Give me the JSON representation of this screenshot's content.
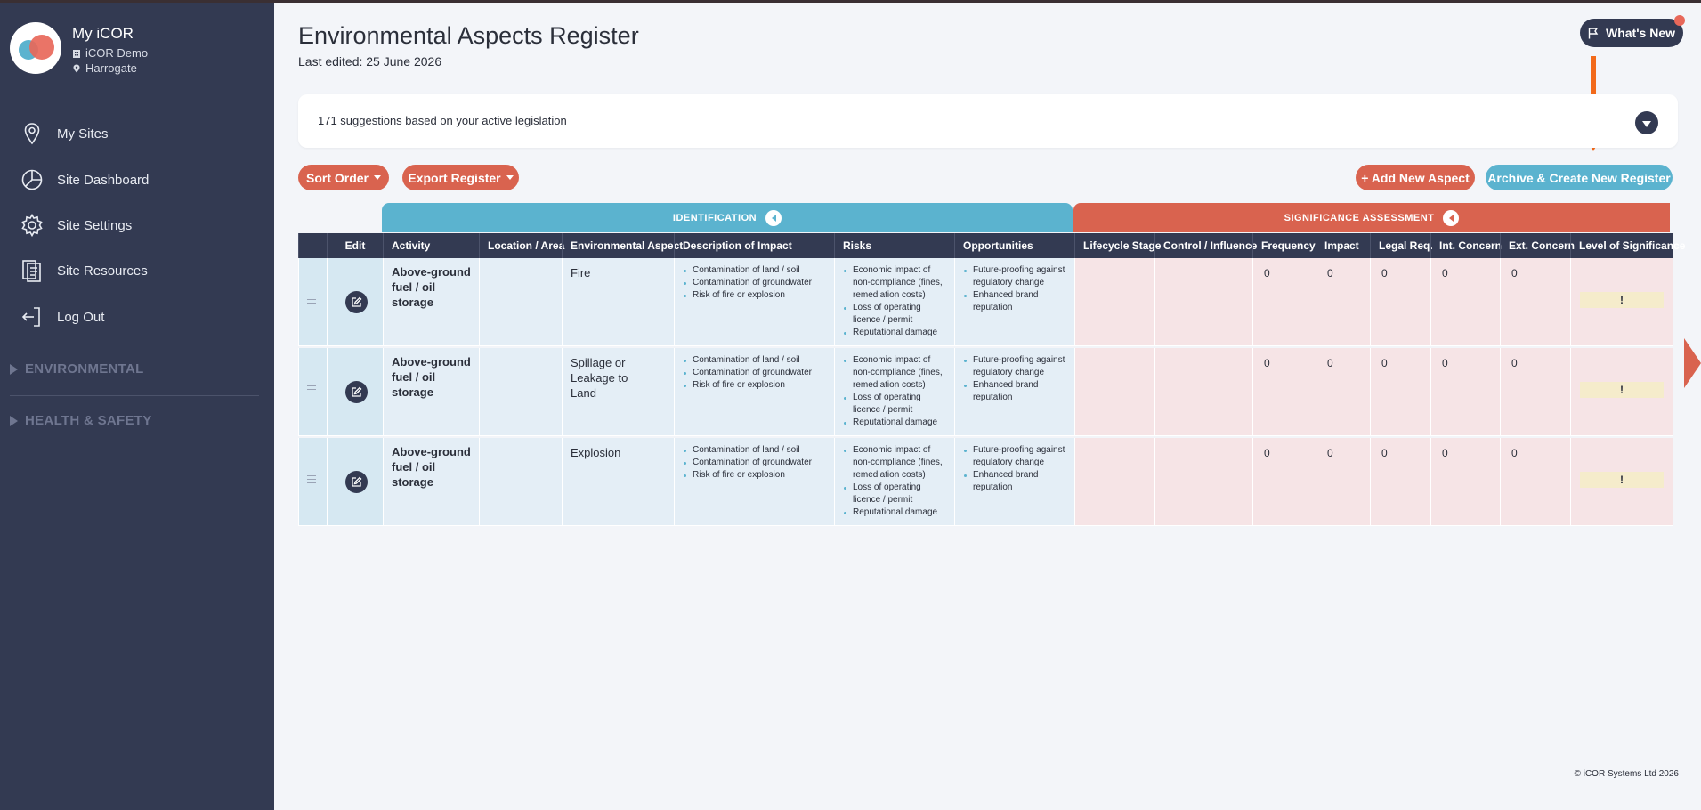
{
  "sidebar": {
    "profile": {
      "name": "My iCOR",
      "org": "iCOR Demo",
      "location": "Harrogate"
    },
    "nav": [
      {
        "label": "My Sites",
        "icon": "map-pin-icon"
      },
      {
        "label": "Site Dashboard",
        "icon": "pie-chart-icon"
      },
      {
        "label": "Site Settings",
        "icon": "gear-icon"
      },
      {
        "label": "Site Resources",
        "icon": "document-icon"
      },
      {
        "label": "Log Out",
        "icon": "logout-icon"
      }
    ],
    "sections": [
      {
        "label": "ENVIRONMENTAL"
      },
      {
        "label": "HEALTH & SAFETY"
      }
    ]
  },
  "header": {
    "title": "Environmental Aspects Register",
    "last_edited": "Last edited: 25 June 2026",
    "whats_new": "What's New"
  },
  "suggestions": {
    "text": "171 suggestions based on your active legislation"
  },
  "toolbar": {
    "sort_order": "Sort Order",
    "export_register": "Export Register",
    "add_new_aspect": "+ Add New Aspect",
    "archive_create": "Archive & Create New Register"
  },
  "table": {
    "groups": {
      "identification": "IDENTIFICATION",
      "significance": "SIGNIFICANCE ASSESSMENT"
    },
    "columns": {
      "edit": "Edit",
      "activity": "Activity",
      "location": "Location / Area",
      "aspect": "Environmental Aspect",
      "impact": "Description of Impact",
      "risks": "Risks",
      "opportunities": "Opportunities",
      "lifecycle": "Lifecycle Stage",
      "control": "Control / Influence",
      "frequency": "Frequency",
      "impact_score": "Impact",
      "legal": "Legal Req.",
      "int_concern": "Int. Concern",
      "ext_concern": "Ext. Concern",
      "significance": "Level of Significance"
    },
    "rows": [
      {
        "activity": "Above-ground fuel / oil storage",
        "location": "",
        "aspect": "Fire",
        "impacts": [
          "Contamination of land / soil",
          "Contamination of groundwater",
          "Risk of fire or explosion"
        ],
        "risks": [
          "Economic impact of non-compliance (fines, remediation costs)",
          "Loss of operating licence / permit",
          "Reputational damage"
        ],
        "opportunities": [
          "Future-proofing against regulatory change",
          "Enhanced brand reputation"
        ],
        "lifecycle": "",
        "control": "",
        "frequency": "0",
        "impact": "0",
        "legal": "0",
        "int_concern": "0",
        "ext_concern": "0",
        "significance": "!"
      },
      {
        "activity": "Above-ground fuel / oil storage",
        "location": "",
        "aspect": "Spillage or Leakage to Land",
        "impacts": [
          "Contamination of land / soil",
          "Contamination of groundwater",
          "Risk of fire or explosion"
        ],
        "risks": [
          "Economic impact of non-compliance (fines, remediation costs)",
          "Loss of operating licence / permit",
          "Reputational damage"
        ],
        "opportunities": [
          "Future-proofing against regulatory change",
          "Enhanced brand reputation"
        ],
        "lifecycle": "",
        "control": "",
        "frequency": "0",
        "impact": "0",
        "legal": "0",
        "int_concern": "0",
        "ext_concern": "0",
        "significance": "!"
      },
      {
        "activity": "Above-ground fuel / oil storage",
        "location": "",
        "aspect": "Explosion",
        "impacts": [
          "Contamination of land / soil",
          "Contamination of groundwater",
          "Risk of fire or explosion"
        ],
        "risks": [
          "Economic impact of non-compliance (fines, remediation costs)",
          "Loss of operating licence / permit",
          "Reputational damage"
        ],
        "opportunities": [
          "Future-proofing against regulatory change",
          "Enhanced brand reputation"
        ],
        "lifecycle": "",
        "control": "",
        "frequency": "0",
        "impact": "0",
        "legal": "0",
        "int_concern": "0",
        "ext_concern": "0",
        "significance": "!"
      }
    ]
  },
  "footer": {
    "copyright": "© iCOR Systems Ltd 2026"
  },
  "colors": {
    "sidebar": "#333a52",
    "accent_red": "#d9634f",
    "accent_blue": "#5bb3cf",
    "annotation_arrow": "#f26a1b"
  }
}
